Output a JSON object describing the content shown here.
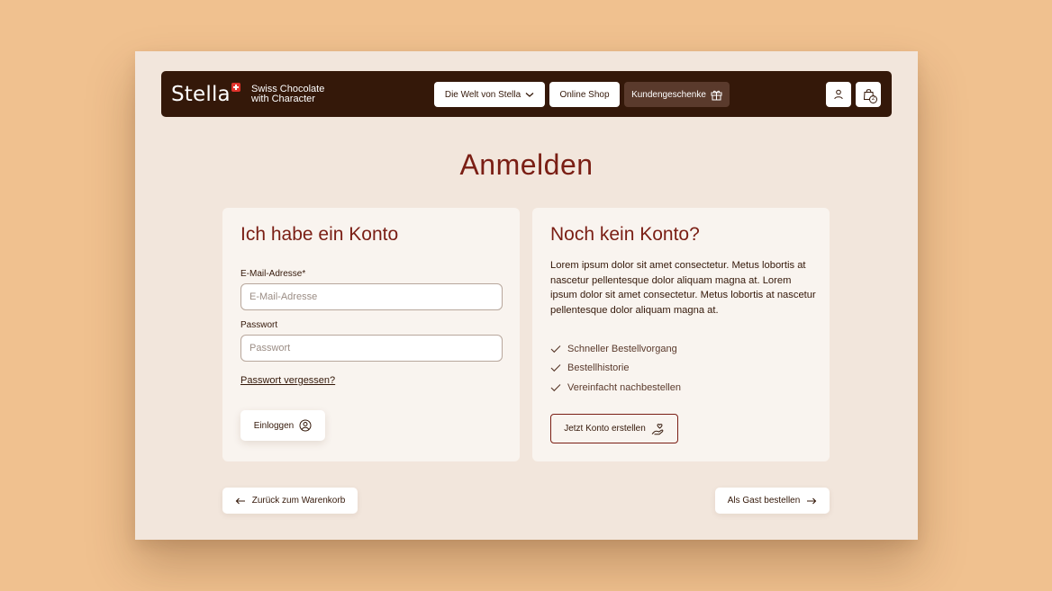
{
  "header": {
    "logo_text": "Stella",
    "tagline_line1": "Swiss Chocolate",
    "tagline_line2": "with Character",
    "nav": {
      "welt_label": "Die Welt von Stella",
      "shop_label": "Online Shop",
      "gifts_label": "Kundengeschenke"
    },
    "cart_count": "2",
    "icons": [
      "chevron-down-icon",
      "gift-icon",
      "user-icon",
      "shopping-bag-icon"
    ]
  },
  "page_title": "Anmelden",
  "login_card": {
    "title": "Ich habe ein Konto",
    "email_label": "E-Mail-Adresse*",
    "email_placeholder": "E-Mail-Adresse",
    "email_value": "",
    "password_label": "Passwort",
    "password_placeholder": "Passwort",
    "password_value": "",
    "forgot_label": "Passwort vergessen?",
    "login_label": "Einloggen"
  },
  "register_card": {
    "title": "Noch kein Konto?",
    "body": "Lorem ipsum dolor sit amet consectetur. Metus lobortis at nascetur pellentesque dolor aliquam magna at. Lorem ipsum dolor sit amet consectetur. Metus lobortis at nascetur pellentesque dolor aliquam magna at.",
    "benefits": [
      "Schneller Bestellvorgang",
      "Bestellhistorie",
      "Vereinfacht nachbestellen"
    ],
    "create_label": "Jetzt Konto erstellen"
  },
  "footer_actions": {
    "back_label": "Zurück zum Warenkorb",
    "guest_label": "Als Gast bestellen"
  },
  "colors": {
    "background": "#f0c18f",
    "header_bg": "#341809",
    "accent": "#7a1e14",
    "card_bg": "#f9f4ef",
    "window_bg": "#f2e6dc"
  }
}
